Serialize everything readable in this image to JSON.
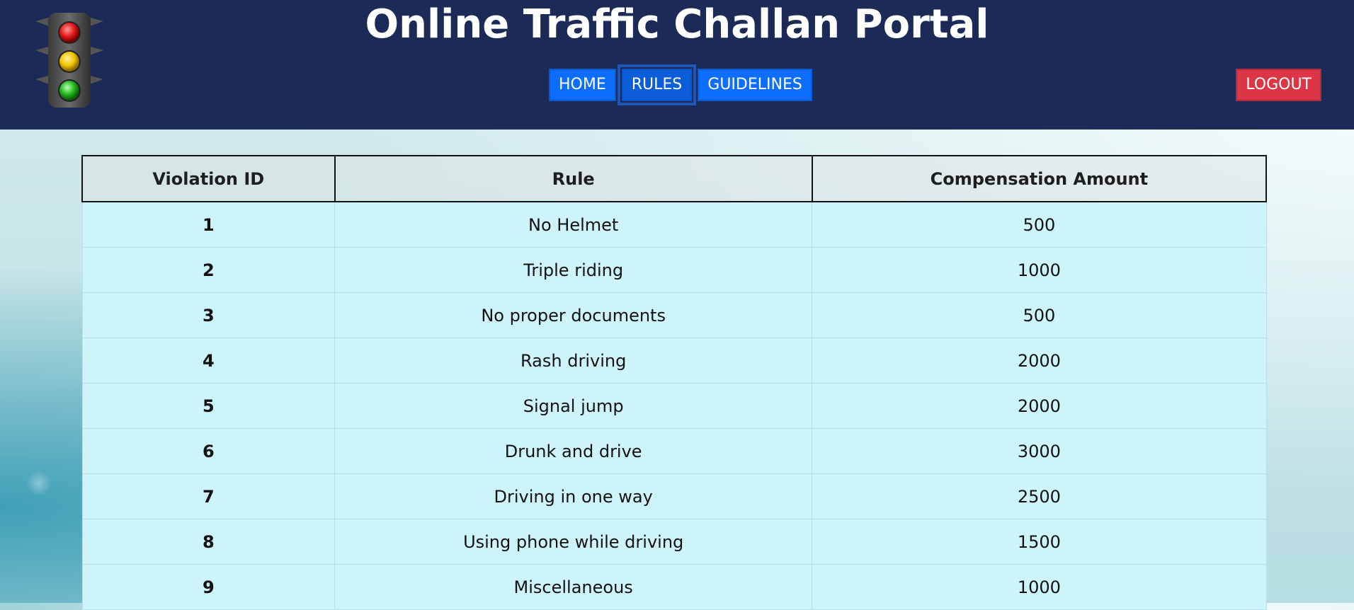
{
  "header": {
    "title": "Online Traffic Challan Portal",
    "logo_icon": "traffic-light-icon"
  },
  "nav": {
    "items": [
      {
        "label": "HOME",
        "active": false
      },
      {
        "label": "RULES",
        "active": true
      },
      {
        "label": "GUIDELINES",
        "active": false
      }
    ],
    "logout_label": "LOGOUT"
  },
  "colors": {
    "header_bg": "#1c2a58",
    "nav_button": "#0d6efd",
    "logout_button": "#dc3545",
    "row_bg": "#cdf4fb"
  },
  "table": {
    "columns": [
      "Violation ID",
      "Rule",
      "Compensation Amount"
    ],
    "rows": [
      {
        "id": "1",
        "rule": "No Helmet",
        "amount": "500"
      },
      {
        "id": "2",
        "rule": "Triple riding",
        "amount": "1000"
      },
      {
        "id": "3",
        "rule": "No proper documents",
        "amount": "500"
      },
      {
        "id": "4",
        "rule": "Rash driving",
        "amount": "2000"
      },
      {
        "id": "5",
        "rule": "Signal jump",
        "amount": "2000"
      },
      {
        "id": "6",
        "rule": "Drunk and drive",
        "amount": "3000"
      },
      {
        "id": "7",
        "rule": "Driving in one way",
        "amount": "2500"
      },
      {
        "id": "8",
        "rule": "Using phone while driving",
        "amount": "1500"
      },
      {
        "id": "9",
        "rule": "Miscellaneous",
        "amount": "1000"
      }
    ]
  }
}
